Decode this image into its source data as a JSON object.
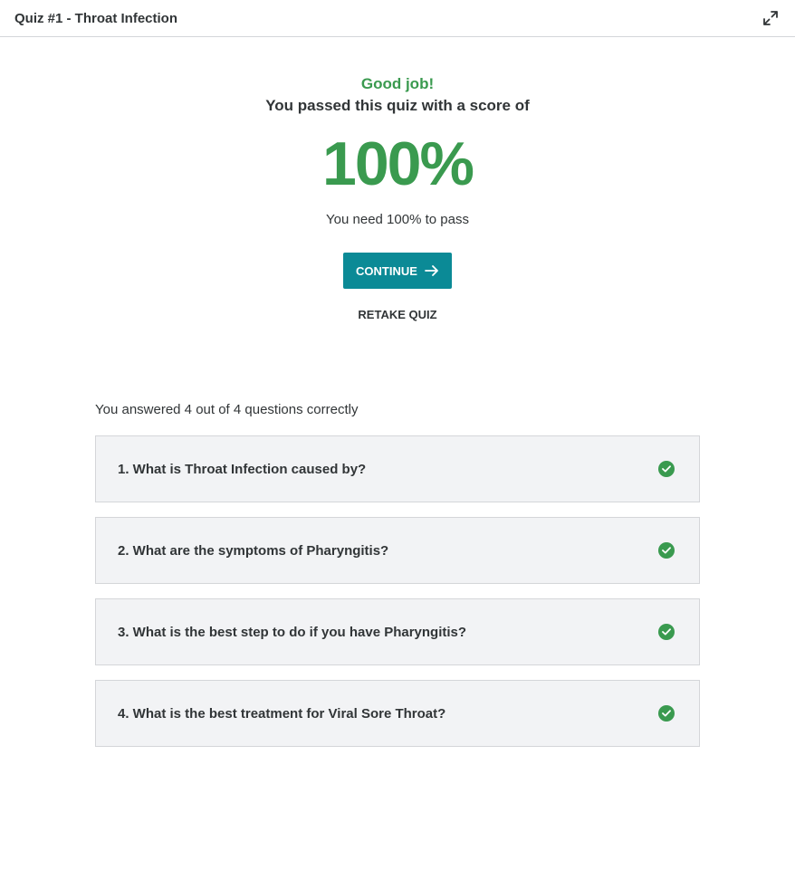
{
  "header": {
    "title": "Quiz #1 - Throat Infection"
  },
  "result": {
    "headline": "Good job!",
    "subtitle": "You passed this quiz with a score of",
    "score": "100%",
    "requirement": "You need 100% to pass",
    "continue_label": "CONTINUE",
    "retake_label": "RETAKE QUIZ"
  },
  "summary": "You answered 4 out of 4 questions correctly",
  "questions": [
    {
      "text": "1. What is Throat Infection caused by?"
    },
    {
      "text": "2. What are the symptoms of Pharyngitis?"
    },
    {
      "text": "3. What is the best step to do if you have Pharyngitis?"
    },
    {
      "text": "4. What is the best treatment for Viral Sore Throat?"
    }
  ],
  "colors": {
    "success": "#3a9a4f",
    "accent": "#0b8a96"
  },
  "icons": {
    "expand": "expand-icon",
    "correct": "check-circle-icon",
    "continue": "arrow-right-icon"
  }
}
